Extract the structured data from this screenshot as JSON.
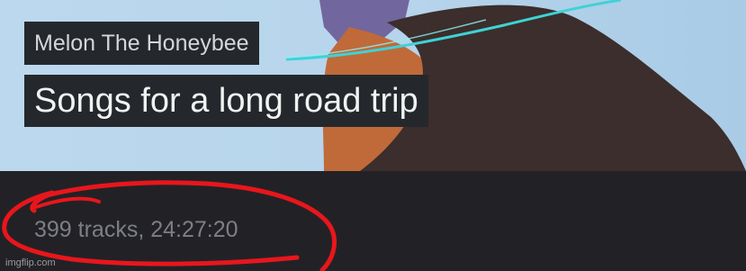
{
  "playlist": {
    "artist": "Melon The Honeybee",
    "title": "Songs for a long road trip",
    "track_info": "399 tracks, 24:27:20"
  },
  "annotation": {
    "shape": "freehand-circle",
    "color": "#e8161c"
  },
  "watermark": "imgflip.com",
  "colors": {
    "hero_background": "#b6d4eb",
    "label_background": "#24282c",
    "footer_background": "#222226"
  }
}
